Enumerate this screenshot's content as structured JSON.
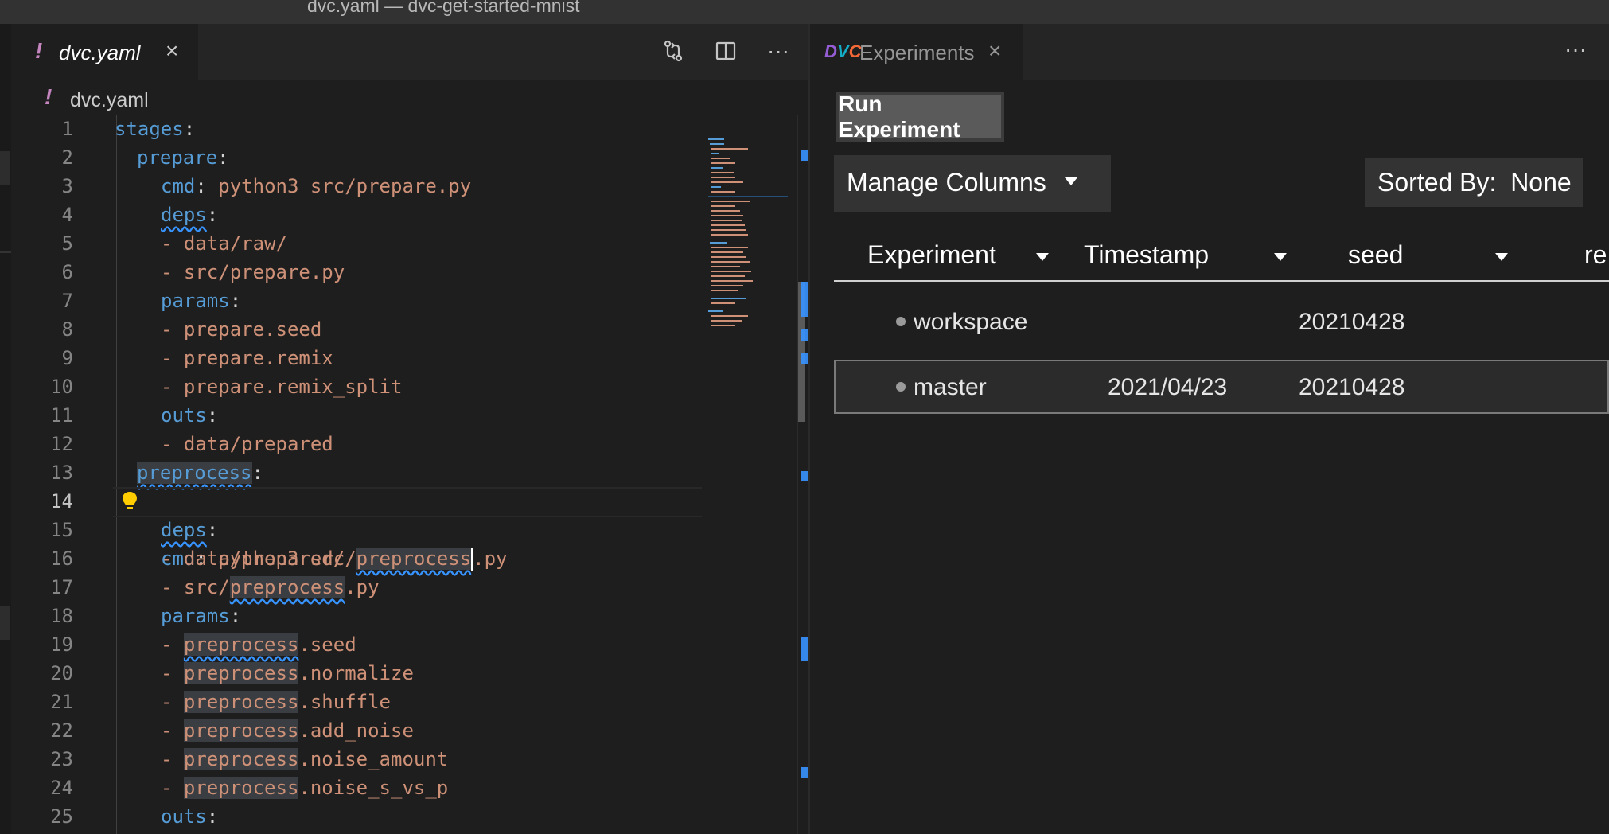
{
  "window": {
    "title": "dvc.yaml — dvc-get-started-mnist"
  },
  "left_editor": {
    "tab": {
      "marker": "!",
      "label": "dvc.yaml",
      "close": "×"
    },
    "actions": {
      "compare": "⇄",
      "split": "◫",
      "more": "···"
    },
    "breadcrumb": {
      "marker": "!",
      "label": "dvc.yaml"
    },
    "lines": [
      {
        "n": "1"
      },
      {
        "n": "2"
      },
      {
        "n": "3"
      },
      {
        "n": "4"
      },
      {
        "n": "5"
      },
      {
        "n": "6"
      },
      {
        "n": "7"
      },
      {
        "n": "8"
      },
      {
        "n": "9"
      },
      {
        "n": "10"
      },
      {
        "n": "11"
      },
      {
        "n": "12"
      },
      {
        "n": "13"
      },
      {
        "n": "14"
      },
      {
        "n": "15"
      },
      {
        "n": "16"
      },
      {
        "n": "17"
      },
      {
        "n": "18"
      },
      {
        "n": "19"
      },
      {
        "n": "20"
      },
      {
        "n": "21"
      },
      {
        "n": "22"
      },
      {
        "n": "23"
      },
      {
        "n": "24"
      },
      {
        "n": "25"
      }
    ],
    "code": {
      "stages": "stages",
      "prepare": "prepare",
      "cmd": "cmd",
      "deps": "deps",
      "params": "params",
      "outs": "outs",
      "preprocess": "preprocess",
      "cmd_prepare": "python3 src/prepare.py",
      "dep_raw": "- data/raw/",
      "dep_prepare_py": "- src/prepare.py",
      "p_seed": "- prepare.seed",
      "p_remix": "- prepare.remix",
      "p_remix_split": "- prepare.remix_split",
      "out_prepared": "- data/prepared",
      "cmd_pre_a": "python3 src/",
      "cmd_pre_b": ".py",
      "dep_prepared": "- data/prepared/",
      "dep_src_a": "- src/",
      "dep_src_b": ".py",
      "dash": "- ",
      "pp_seed": ".seed",
      "pp_normalize": ".normalize",
      "pp_shuffle": ".shuffle",
      "pp_add_noise": ".add_noise",
      "pp_noise_amount": ".noise_amount",
      "pp_noise_s_vs_p": ".noise_s_vs_p",
      "colon": ":"
    }
  },
  "experiments": {
    "tab": {
      "label": "Experiments",
      "close": "×",
      "logo_d": "D",
      "logo_v": "V",
      "logo_c": "C"
    },
    "more": "···",
    "run_button": "Run Experiment",
    "manage_columns": "Manage Columns",
    "sorted_by": "Sorted By:  None",
    "columns": [
      "Experiment",
      "Timestamp",
      "seed",
      "re"
    ],
    "rows": [
      {
        "experiment": "workspace",
        "timestamp": "",
        "seed": "20210428"
      },
      {
        "experiment": "master",
        "timestamp": "2021/04/23",
        "seed": "20210428"
      }
    ]
  }
}
